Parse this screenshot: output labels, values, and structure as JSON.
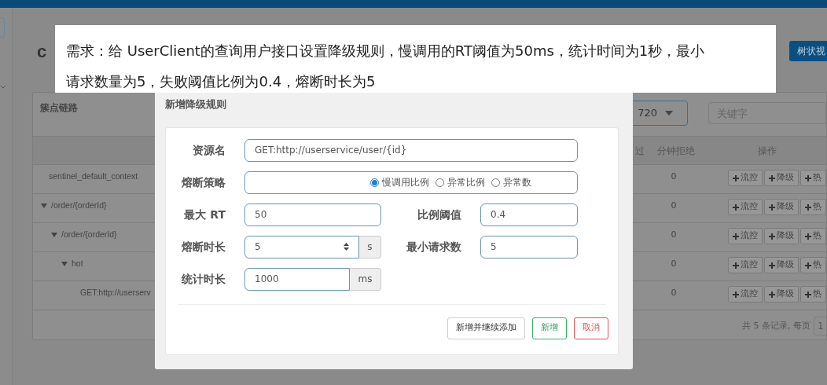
{
  "page": {
    "heading_fragment": "c",
    "view_button": "树状视",
    "tree_title": "簇点链路",
    "app_select": "720",
    "search": {
      "placeholder": "关键字"
    },
    "columns": [
      "过",
      "分钟拒绝",
      "操作"
    ],
    "rows": [
      {
        "name": "sentinel_default_context",
        "minute_reject": "0",
        "actions": [
          "流控",
          "降级",
          "热"
        ]
      },
      {
        "name": "/order/{orderId}",
        "expanded": true,
        "minute_reject": "0",
        "actions": [
          "流控",
          "降级",
          "热"
        ],
        "children": [
          {
            "name": "/order/{orderId}",
            "expanded": true,
            "minute_reject": "0",
            "actions": [
              "流控",
              "降级",
              "热"
            ],
            "children": [
              {
                "name": "hot",
                "expanded": true,
                "minute_reject": "0",
                "actions": [
                  "流控",
                  "降级",
                  "热"
                ],
                "children": [
                  {
                    "name": "GET:http://userserv",
                    "minute_reject": "0",
                    "actions": [
                      "流控",
                      "降级",
                      "热"
                    ]
                  }
                ]
              }
            ]
          }
        ]
      }
    ],
    "footer": "共 5 条记录, 每页",
    "page_size": "1"
  },
  "annotation": "需求：给 UserClient的查询用户接口设置降级规则，慢调用的RT阈值为50ms，统计时间为1秒，最小请求数量为5，失败阈值比例为0.4，熔断时长为5",
  "dialog": {
    "title": "新增降级规则",
    "resource": {
      "label": "资源名",
      "value": "GET:http://userservice/user/{id}"
    },
    "strategy": {
      "label": "熔断策略",
      "options": [
        {
          "label": "慢调用比例",
          "selected": true
        },
        {
          "label": "异常比例",
          "selected": false
        },
        {
          "label": "异常数",
          "selected": false
        }
      ]
    },
    "max_rt": {
      "label": "最大 RT",
      "value": "50"
    },
    "ratio": {
      "label": "比例阈值",
      "value": "0.4"
    },
    "duration": {
      "label": "熔断时长",
      "value": "5",
      "unit": "s"
    },
    "min_requests": {
      "label": "最小请求数",
      "value": "5"
    },
    "stat_duration": {
      "label": "统计时长",
      "value": "1000",
      "unit": "ms"
    },
    "buttons": [
      {
        "label": "新增并继续添加",
        "kind": "default"
      },
      {
        "label": "新增",
        "kind": "success"
      },
      {
        "label": "取消",
        "kind": "danger"
      }
    ]
  }
}
